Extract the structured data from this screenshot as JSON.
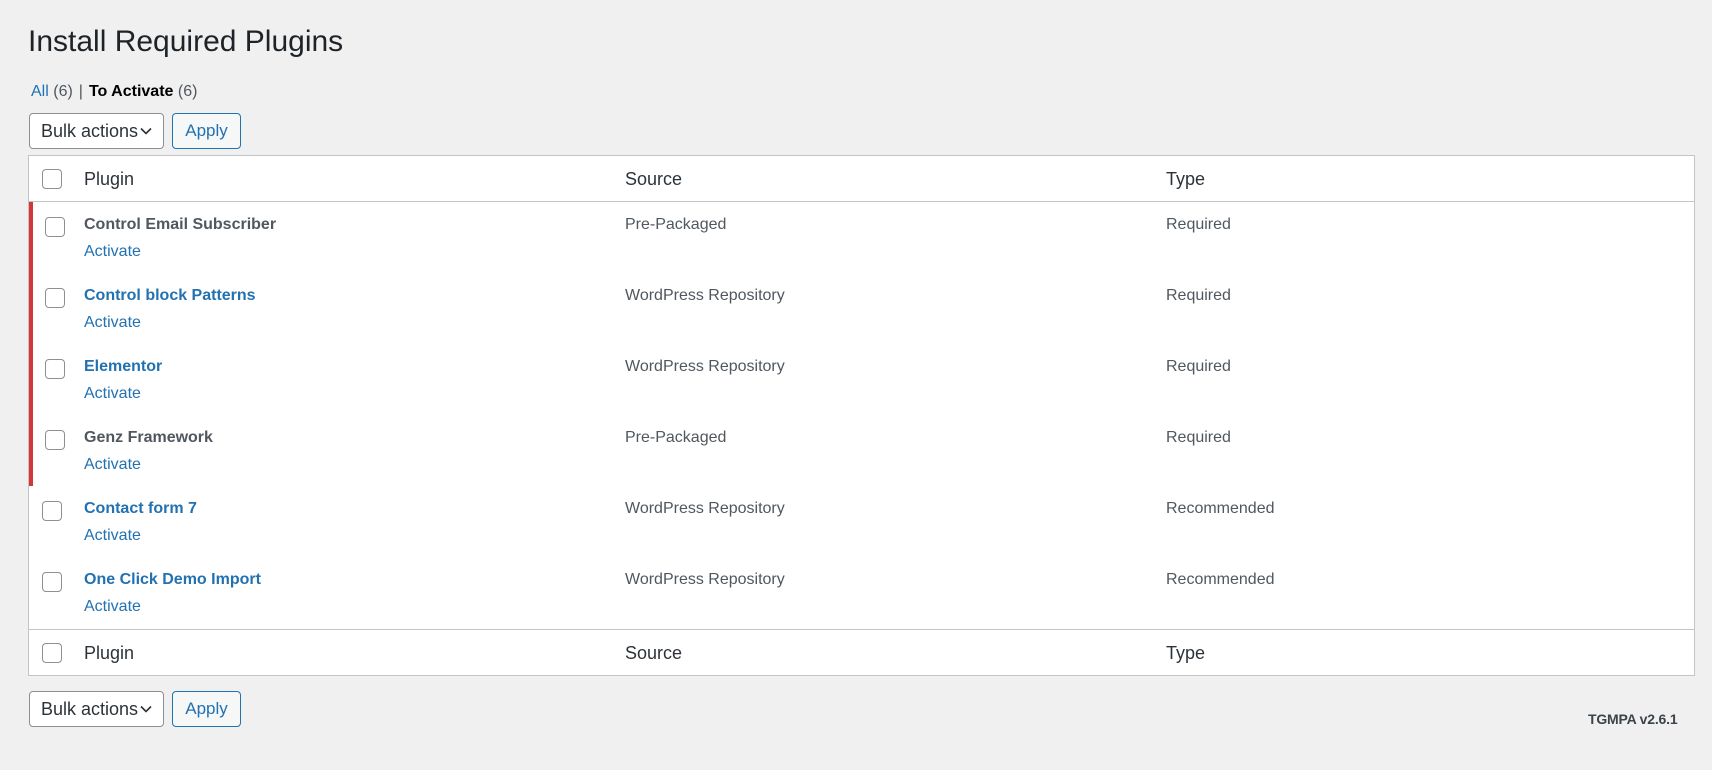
{
  "page": {
    "title": "Install Required Plugins"
  },
  "filters": {
    "all_label": "All",
    "all_count": "(6)",
    "separator": "|",
    "to_activate_label": "To Activate",
    "to_activate_count": "(6)"
  },
  "tablenav": {
    "bulk_actions_selected": "Bulk actions",
    "apply_label": "Apply"
  },
  "table": {
    "columns": [
      "Plugin",
      "Source",
      "Type"
    ],
    "rows": [
      {
        "name": "Control Email Subscriber",
        "linked": false,
        "action": "Activate",
        "source": "Pre-Packaged",
        "type": "Required",
        "required": true
      },
      {
        "name": "Control block Patterns",
        "linked": true,
        "action": "Activate",
        "source": "WordPress Repository",
        "type": "Required",
        "required": true
      },
      {
        "name": "Elementor",
        "linked": true,
        "action": "Activate",
        "source": "WordPress Repository",
        "type": "Required",
        "required": true
      },
      {
        "name": "Genz Framework",
        "linked": false,
        "action": "Activate",
        "source": "Pre-Packaged",
        "type": "Required",
        "required": true
      },
      {
        "name": "Contact form 7",
        "linked": true,
        "action": "Activate",
        "source": "WordPress Repository",
        "type": "Recommended",
        "required": false
      },
      {
        "name": "One Click Demo Import",
        "linked": true,
        "action": "Activate",
        "source": "WordPress Repository",
        "type": "Recommended",
        "required": false
      }
    ]
  },
  "footer": {
    "version": "TGMPA v2.6.1"
  },
  "colors": {
    "link": "#2271b1",
    "required_border": "#d63638",
    "background": "#f0f0f1"
  }
}
